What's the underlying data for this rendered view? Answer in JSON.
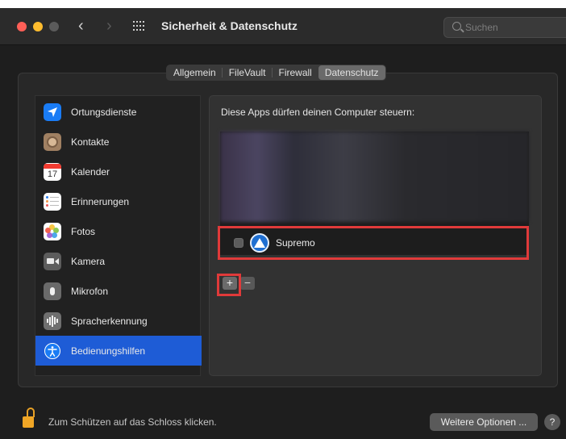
{
  "window": {
    "title": "Sicherheit & Datenschutz",
    "nav_back": "‹",
    "nav_forward": "›"
  },
  "search": {
    "placeholder": "Suchen"
  },
  "tabs": [
    {
      "label": "Allgemein",
      "active": false
    },
    {
      "label": "FileVault",
      "active": false
    },
    {
      "label": "Firewall",
      "active": false
    },
    {
      "label": "Datenschutz",
      "active": true
    }
  ],
  "sidebar": {
    "items": [
      {
        "label": "Ortungsdienste",
        "icon": "location-arrow-icon"
      },
      {
        "label": "Kontakte",
        "icon": "contacts-icon"
      },
      {
        "label": "Kalender",
        "icon": "calendar-icon",
        "badge": "17"
      },
      {
        "label": "Erinnerungen",
        "icon": "reminders-icon"
      },
      {
        "label": "Fotos",
        "icon": "photos-icon"
      },
      {
        "label": "Kamera",
        "icon": "camera-icon"
      },
      {
        "label": "Mikrofon",
        "icon": "microphone-icon"
      },
      {
        "label": "Spracherkennung",
        "icon": "speech-recognition-icon"
      },
      {
        "label": "Bedienungshilfen",
        "icon": "accessibility-icon",
        "selected": true
      }
    ]
  },
  "content": {
    "heading": "Diese Apps dürfen deinen Computer steuern:",
    "apps": [
      {
        "name": "Supremo",
        "checked": false,
        "icon": "supremo-app-icon"
      }
    ],
    "add_label": "+",
    "remove_label": "−"
  },
  "footer": {
    "lock_text": "Zum Schützen auf das Schloss klicken.",
    "more_options": "Weitere Optionen ...",
    "help": "?"
  },
  "colors": {
    "selection": "#1e5cd6",
    "highlight": "#e03a3a",
    "close": "#ff5f57",
    "minimize": "#febc2e"
  }
}
